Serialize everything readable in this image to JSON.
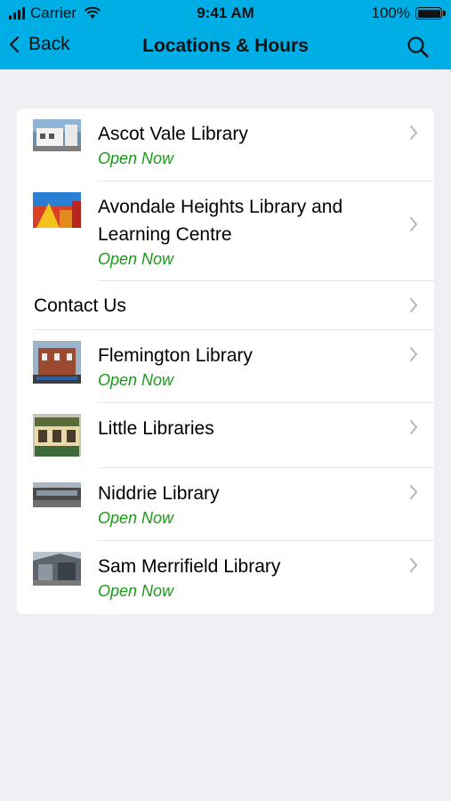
{
  "status_bar": {
    "carrier": "Carrier",
    "time": "9:41 AM",
    "battery": "100%",
    "battery_level": 1.0
  },
  "nav": {
    "back_label": "Back",
    "title": "Locations & Hours"
  },
  "colors": {
    "header": "#00aee6",
    "open_status": "#1a9a1a",
    "background": "#efeff4"
  },
  "locations": [
    {
      "name": "Ascot Vale Library",
      "status": "Open Now"
    },
    {
      "name": "Avondale Heights Library and Learning Centre",
      "status": "Open Now"
    },
    {
      "name": "Contact Us"
    },
    {
      "name": "Flemington Library",
      "status": "Open Now"
    },
    {
      "name": "Little Libraries"
    },
    {
      "name": "Niddrie Library",
      "status": "Open Now"
    },
    {
      "name": "Sam Merrifield Library",
      "status": "Open Now"
    }
  ]
}
